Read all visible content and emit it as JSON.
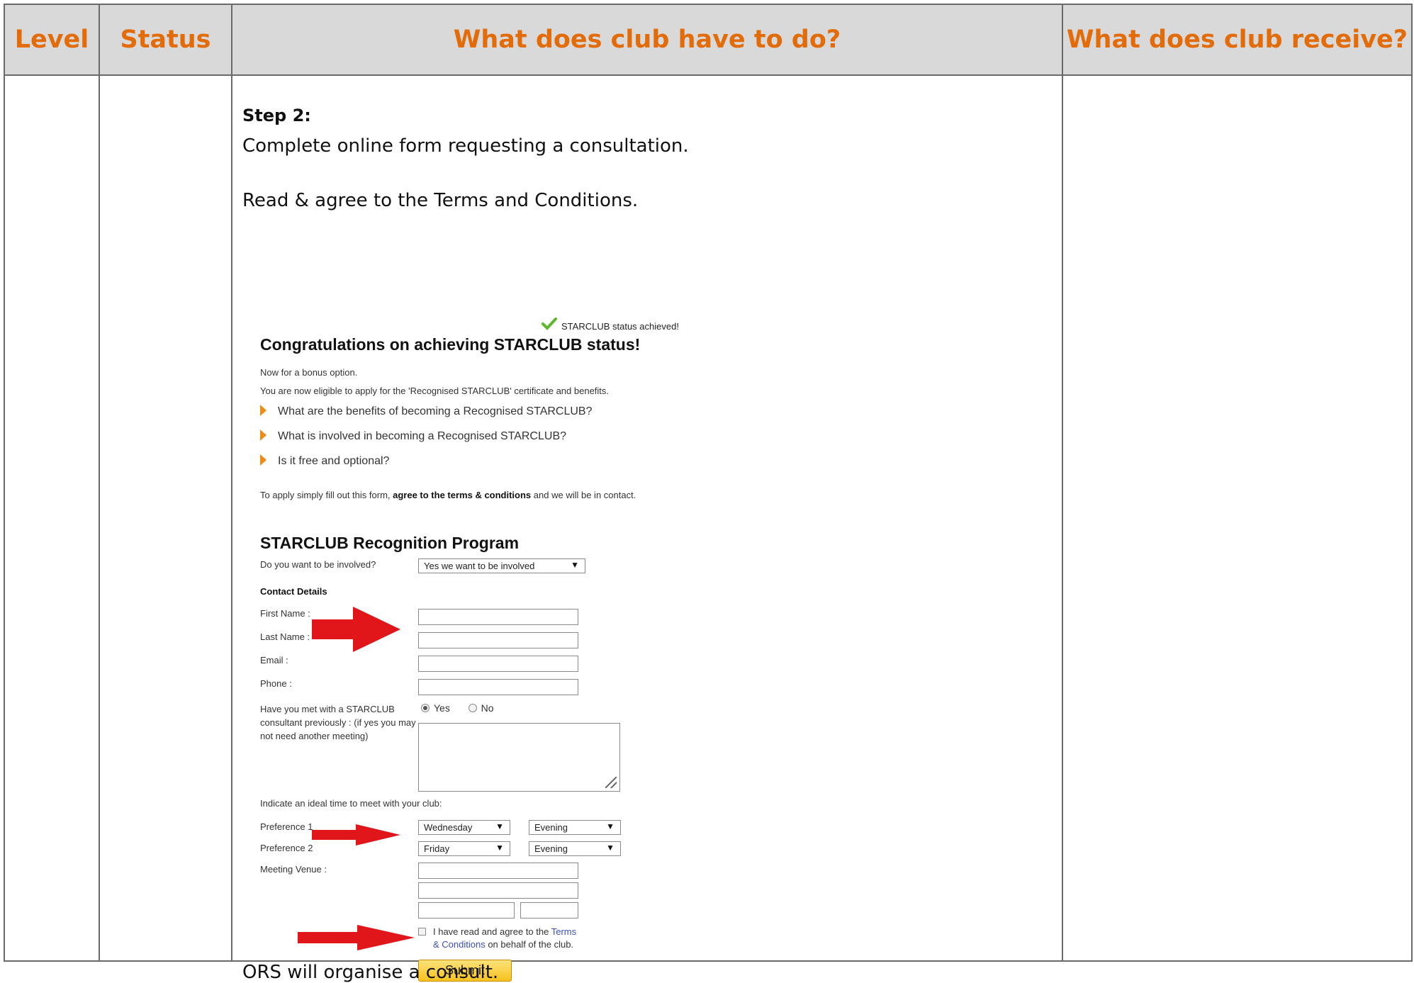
{
  "headers": {
    "level": "Level",
    "status": "Status",
    "todo": "What does club have to do?",
    "receive": "What does club receive?"
  },
  "step": {
    "title": "Step 2:",
    "line1": "Complete online form requesting a consultation.",
    "line2": "Read & agree to the Terms and Conditions.",
    "footer": "ORS will organise a consult."
  },
  "form": {
    "status_text": "STARCLUB status achieved!",
    "congrats_title": "Congratulations on achieving STARCLUB status!",
    "bonus_text": "Now for a bonus option.",
    "eligible_text": "You are now eligible to apply for the 'Recognised STARCLUB' certificate and benefits.",
    "faq": [
      "What are the benefits of becoming a Recognised STARCLUB?",
      "What is involved in becoming a Recognised STARCLUB?",
      "Is it free and optional?"
    ],
    "apply_prefix": "To apply simply fill out this form, ",
    "apply_bold": "agree to the terms & conditions",
    "apply_suffix": " and we will be in contact.",
    "program_title": "STARCLUB Recognition Program",
    "involved_label": "Do you want to be involved?",
    "involved_value": "Yes we want to be involved",
    "contact_heading": "Contact Details",
    "first_name_label": "First Name :",
    "last_name_label": "Last Name :",
    "email_label": "Email :",
    "phone_label": "Phone :",
    "met_label": "Have you met with a STARCLUB consultant previously : (if yes you may not need another meeting)",
    "radio_yes": "Yes",
    "radio_no": "No",
    "ideal_time_label": "Indicate an ideal time to meet with your club:",
    "pref1_label": "Preference 1",
    "pref2_label": "Preference 2",
    "pref1_day": "Wednesday",
    "pref1_time": "Evening",
    "pref2_day": "Friday",
    "pref2_time": "Evening",
    "venue_label": "Meeting Venue :",
    "agree_prefix": "I have read and agree to the ",
    "agree_link1": "Terms",
    "agree_link2": "& Conditions",
    "agree_suffix": " on behalf of the club.",
    "submit_label": "Submit",
    "dropdown_arrow": "▼"
  },
  "colors": {
    "header_text": "#e36c0a",
    "header_bg": "#d9d9d9",
    "arrow_red": "#e0161b",
    "check_green": "#5cb82a"
  },
  "icons": [
    "check-icon",
    "bullet-triangle-icon",
    "red-arrow-icon",
    "dropdown-arrow-icon",
    "resize-grip-icon"
  ]
}
